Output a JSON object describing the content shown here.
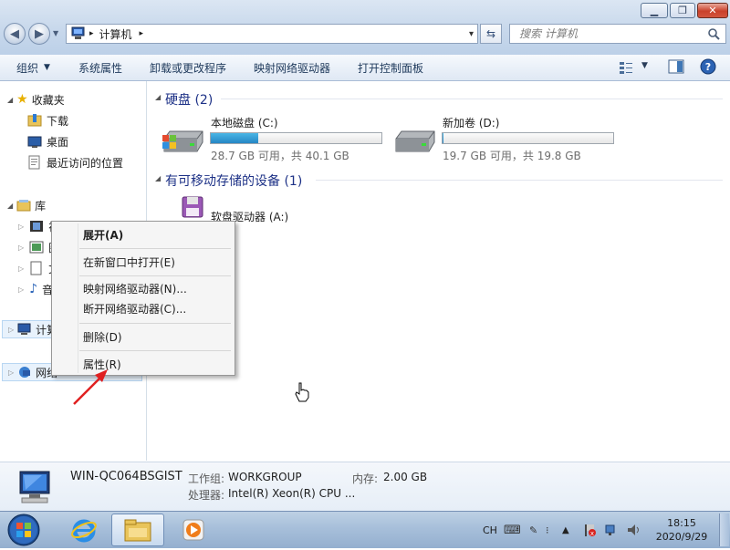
{
  "window": {
    "controls": {
      "minimize": "▁",
      "maximize": "❐",
      "close": "✕"
    }
  },
  "address": {
    "crumb": "计算机",
    "sep1": "▸",
    "sep2": "▸",
    "dropdown": "▾"
  },
  "search": {
    "placeholder": "搜索 计算机"
  },
  "toolbar": {
    "organize": "组织",
    "system_properties": "系统属性",
    "uninstall": "卸载或更改程序",
    "map_drive": "映射网络驱动器",
    "control_panel": "打开控制面板"
  },
  "nav": {
    "favorites": {
      "label": "收藏夹",
      "items": [
        "下载",
        "桌面",
        "最近访问的位置"
      ]
    },
    "libraries": {
      "label": "库",
      "items": [
        "视频",
        "图片",
        "文档",
        "音乐"
      ]
    },
    "computer": "计算机",
    "network": "网络"
  },
  "content": {
    "hard_disks": {
      "header": "硬盘 (2)"
    },
    "drives": [
      {
        "name": "本地磁盘 (C:)",
        "info": "28.7 GB 可用，共 40.1 GB",
        "used_fraction": 0.28
      },
      {
        "name": "新加卷 (D:)",
        "info": "19.7 GB 可用，共 19.8 GB",
        "used_fraction": 0.005
      }
    ],
    "removable": {
      "header": "有可移动存储的设备 (1)"
    },
    "floppy": {
      "name": "软盘驱动器 (A:)"
    }
  },
  "context_menu": {
    "items": [
      "展开(A)",
      "在新窗口中打开(E)",
      "映射网络驱动器(N)...",
      "断开网络驱动器(C)...",
      "删除(D)",
      "属性(R)"
    ]
  },
  "details": {
    "computer_name": "WIN-QC064BSGIST",
    "workgroup_label": "工作组:",
    "workgroup": "WORKGROUP",
    "memory_label": "内存:",
    "memory": "2.00 GB",
    "cpu_label": "处理器:",
    "cpu": "Intel(R) Xeon(R) CPU ..."
  },
  "taskbar": {
    "lang": "CH",
    "time": "18:15",
    "date": "2020/9/29"
  },
  "colors": {
    "accent": "#1e3287",
    "bar_fill": "#2686c4",
    "arrow": "#e02020"
  }
}
